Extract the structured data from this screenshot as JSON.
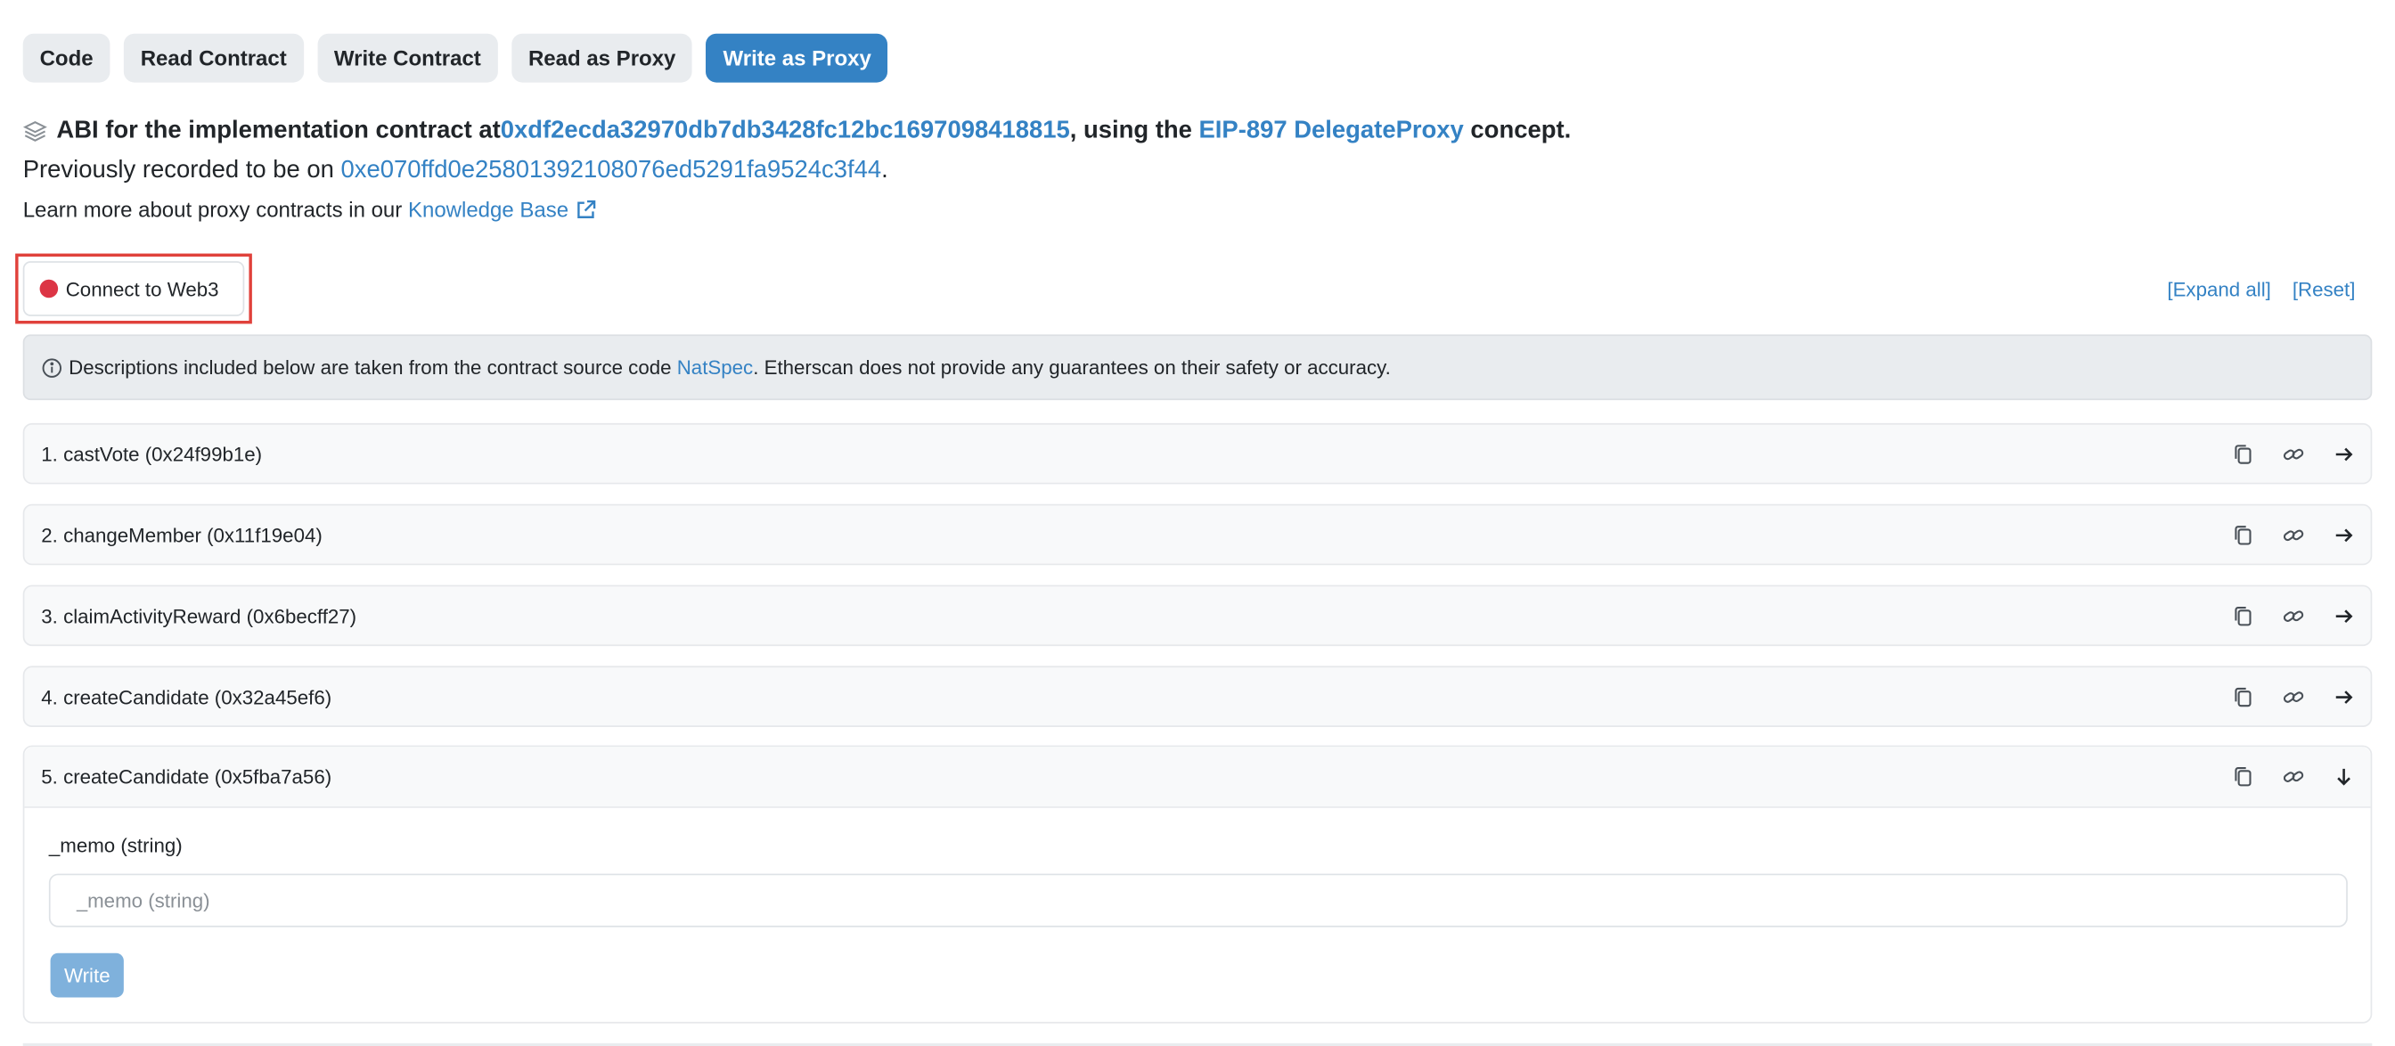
{
  "tabs": [
    "Code",
    "Read Contract",
    "Write Contract",
    "Read as Proxy",
    "Write as Proxy"
  ],
  "active_tab": "Write as Proxy",
  "proxy_info": {
    "abi_prefix": "ABI for the implementation contract at ",
    "implementation_address": "0xdf2ecda32970db7db3428fc12bc1697098418815",
    "using_the": ", using the ",
    "eip_link": "EIP-897 DelegateProxy",
    "concept": " concept.",
    "previously_prefix": "Previously recorded to be on ",
    "previous_address": "0xe070ffd0e25801392108076ed5291fa9524c3f44",
    "previous_suffix": ".",
    "learn_prefix": "Learn more about proxy contracts in our ",
    "knowledge_base": "Knowledge Base"
  },
  "connect_label": "Connect to Web3",
  "expand_all": "[Expand all]",
  "reset": "[Reset]",
  "notice": {
    "prefix": "Descriptions included below are taken from the contract source code ",
    "link": "NatSpec",
    "suffix": ". Etherscan does not provide any guarantees on their safety or accuracy."
  },
  "functions": [
    "1. castVote (0x24f99b1e)",
    "2. changeMember (0x11f19e04)",
    "3. claimActivityReward (0x6becff27)",
    "4. createCandidate (0x32a45ef6)",
    "5. createCandidate (0x5fba7a56)"
  ],
  "expanded_function": {
    "param_label": "_memo (string)",
    "param_placeholder": "_memo (string)",
    "write_label": "Write"
  },
  "colors": {
    "primary": "#3482c4",
    "status_disconnected": "#dc3545",
    "highlight_box": "#e0413b"
  }
}
